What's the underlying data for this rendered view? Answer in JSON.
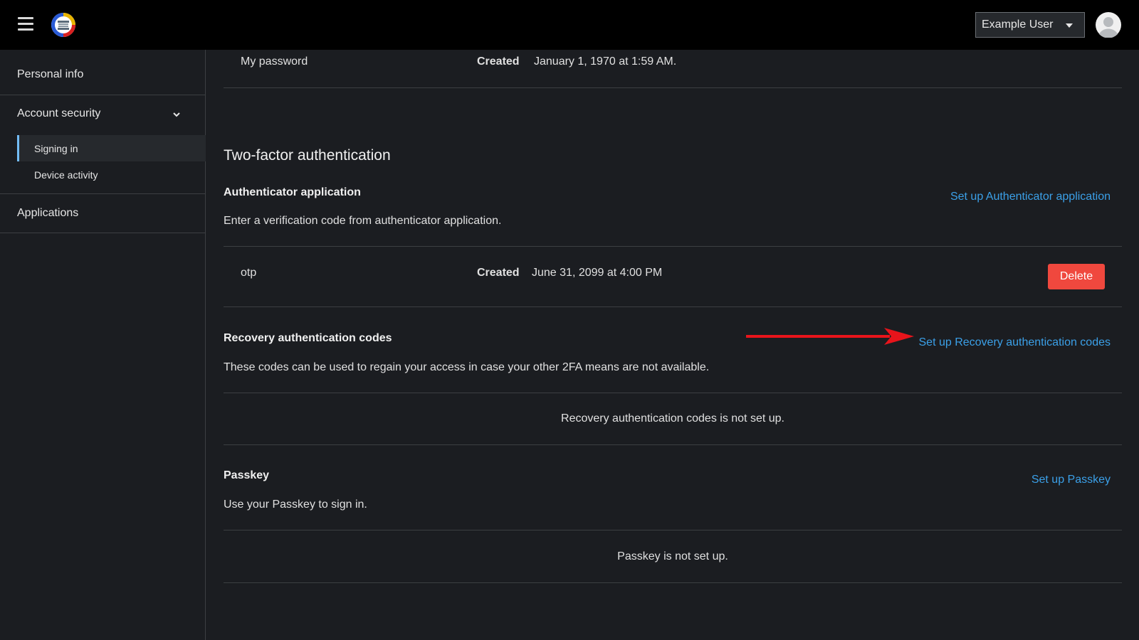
{
  "header": {
    "menu_icon": "hamburger-menu-icon",
    "logo_icon": "brand-logo-icon",
    "user_name": "Example User",
    "avatar_icon": "user-avatar-icon"
  },
  "sidebar": {
    "personal_info": "Personal info",
    "account_security": "Account security",
    "signing_in": "Signing in",
    "device_activity": "Device activity",
    "applications": "Applications"
  },
  "password": {
    "label": "My password",
    "created_label": "Created",
    "created_value": "January 1, 1970 at 1:59 AM."
  },
  "two_factor": {
    "title": "Two-factor authentication",
    "authenticator": {
      "title": "Authenticator application",
      "description": "Enter a verification code from authenticator application.",
      "setup_link": "Set up Authenticator application",
      "item_label": "otp",
      "created_label": "Created",
      "created_value": "June 31, 2099 at 4:00 PM",
      "delete_label": "Delete"
    },
    "recovery": {
      "title": "Recovery authentication codes",
      "description": "These codes can be used to regain your access in case your other 2FA means are not available.",
      "setup_link": "Set up Recovery authentication codes",
      "empty_text": "Recovery authentication codes is not set up."
    },
    "passkey": {
      "title": "Passkey",
      "description": "Use your Passkey to sign in.",
      "setup_link": "Set up Passkey",
      "empty_text": "Passkey is not set up."
    }
  },
  "colors": {
    "accent_link": "#3ba0e8",
    "danger": "#f0483e",
    "annotation_arrow": "#e8141b"
  }
}
